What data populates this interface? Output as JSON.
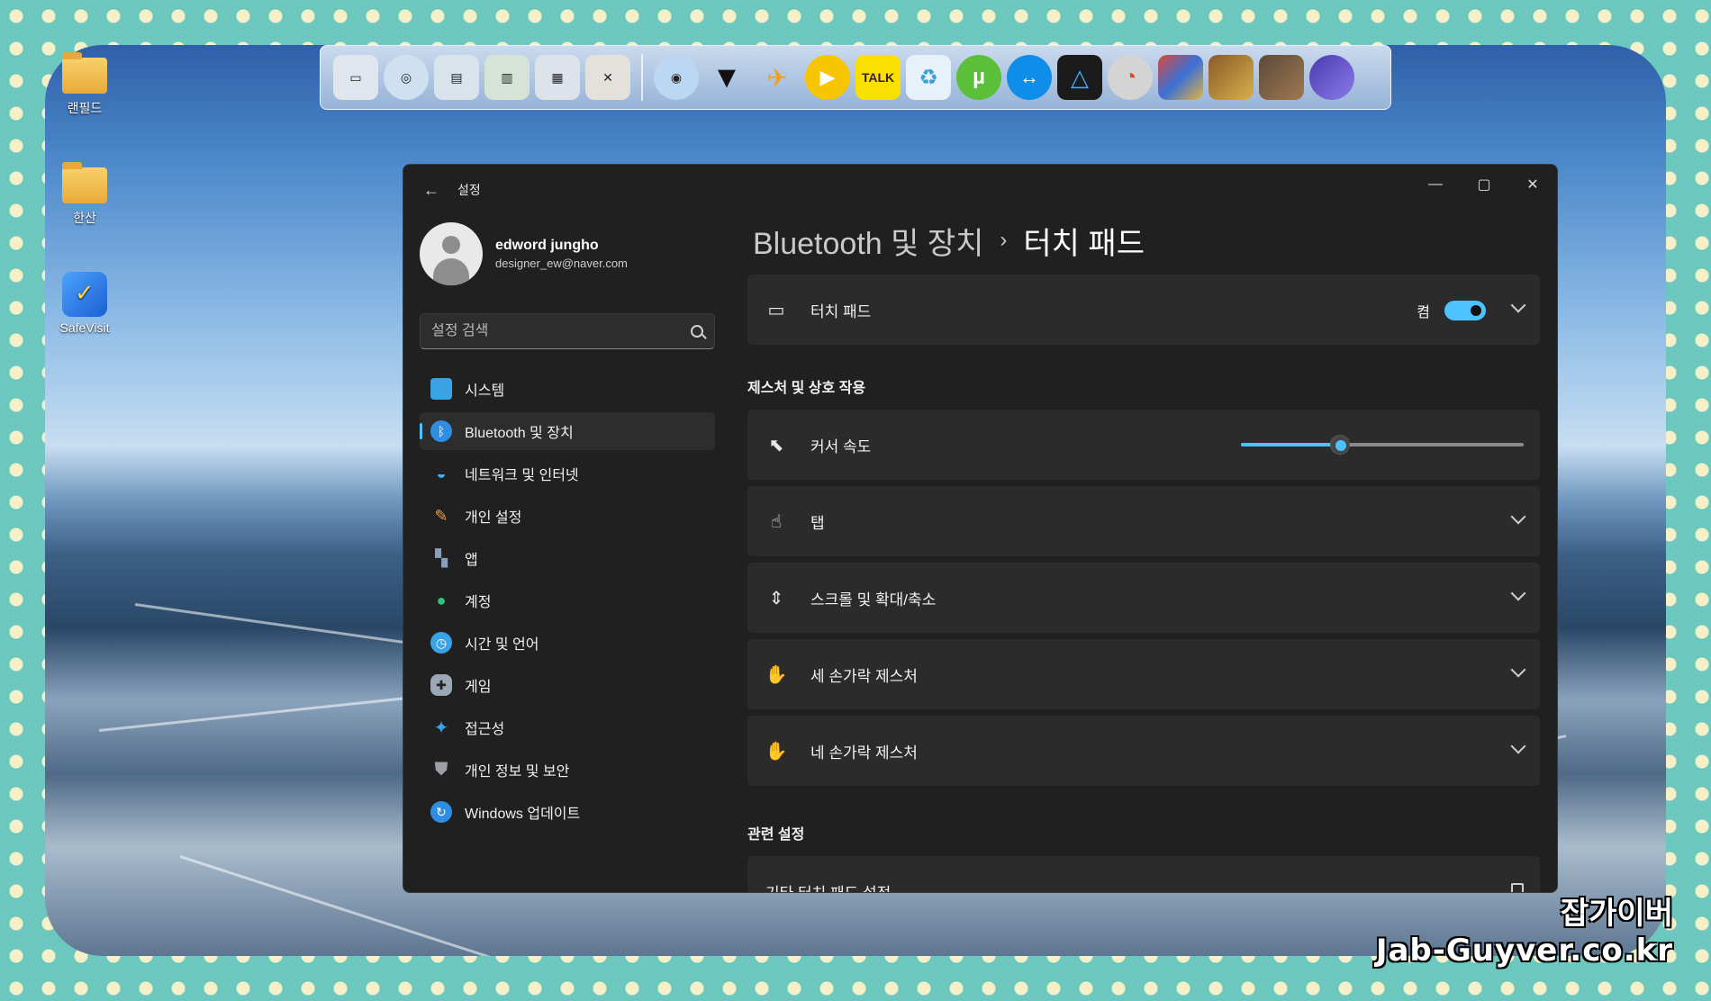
{
  "desktop": {
    "icons": [
      {
        "label": "랜필드"
      },
      {
        "label": "한산"
      },
      {
        "label": "SafeVisit"
      }
    ],
    "dock_icons": [
      {
        "name": "my-computer-icon"
      },
      {
        "name": "network-icon"
      },
      {
        "name": "documents-icon"
      },
      {
        "name": "folder-icon"
      },
      {
        "name": "control-panel-icon"
      },
      {
        "name": "tools-icon"
      },
      {
        "name": "globe-icon"
      },
      {
        "name": "tshirt-icon"
      },
      {
        "name": "plane-icon"
      },
      {
        "name": "play-icon"
      },
      {
        "name": "kakaotalk-icon",
        "text": "TALK"
      },
      {
        "name": "recycle-bin-icon"
      },
      {
        "name": "utorrent-icon"
      },
      {
        "name": "teamviewer-icon"
      },
      {
        "name": "triangle-app-icon"
      },
      {
        "name": "photo-app-icon"
      },
      {
        "name": "game-art-icon"
      },
      {
        "name": "castle-icon"
      },
      {
        "name": "warrior-icon"
      },
      {
        "name": "tree-icon"
      }
    ]
  },
  "window": {
    "title": "설정",
    "profile": {
      "name": "edword jungho",
      "email": "designer_ew@naver.com"
    },
    "search": {
      "placeholder": "설정 검색"
    },
    "nav": [
      {
        "label": "시스템",
        "icon": "monitor-icon",
        "color": "#3aa3e6"
      },
      {
        "label": "Bluetooth 및 장치",
        "icon": "bluetooth-icon",
        "color": "#2f8de4",
        "active": true
      },
      {
        "label": "네트워크 및 인터넷",
        "icon": "wifi-icon",
        "color": "#38b6ff"
      },
      {
        "label": "개인 설정",
        "icon": "brush-icon",
        "color": "#e8a04a"
      },
      {
        "label": "앱",
        "icon": "apps-icon",
        "color": "#8aa0b8"
      },
      {
        "label": "계정",
        "icon": "person-icon",
        "color": "#2ec27e"
      },
      {
        "label": "시간 및 언어",
        "icon": "globe-clock-icon",
        "color": "#3aa3e6"
      },
      {
        "label": "게임",
        "icon": "gamepad-icon",
        "color": "#9aa7b4"
      },
      {
        "label": "접근성",
        "icon": "accessibility-icon",
        "color": "#3aa3e6"
      },
      {
        "label": "개인 정보 및 보안",
        "icon": "shield-icon",
        "color": "#9aa0a6"
      },
      {
        "label": "Windows 업데이트",
        "icon": "update-icon",
        "color": "#2f8de4"
      }
    ],
    "breadcrumb": {
      "parent": "Bluetooth 및 장치",
      "separator": "›",
      "current": "터치 패드"
    },
    "touchpad_card": {
      "label": "터치 패드",
      "state_label": "켬",
      "on": true
    },
    "gestures_section": "제스처 및 상호 작용",
    "cursor_speed": {
      "label": "커서 속도",
      "value_percent": 35
    },
    "cards": [
      {
        "label": "탭",
        "icon": "tap-icon"
      },
      {
        "label": "스크롤 및 확대/축소",
        "icon": "scroll-icon"
      },
      {
        "label": "세 손가락 제스처",
        "icon": "three-finger-icon"
      },
      {
        "label": "네 손가락 제스처",
        "icon": "four-finger-icon"
      }
    ],
    "related_section": "관련 설정",
    "related_link": "기타 터치 패드 설정"
  },
  "watermark": {
    "line1": "잡가이버",
    "line2": "Jab-Guyver.co.kr"
  }
}
